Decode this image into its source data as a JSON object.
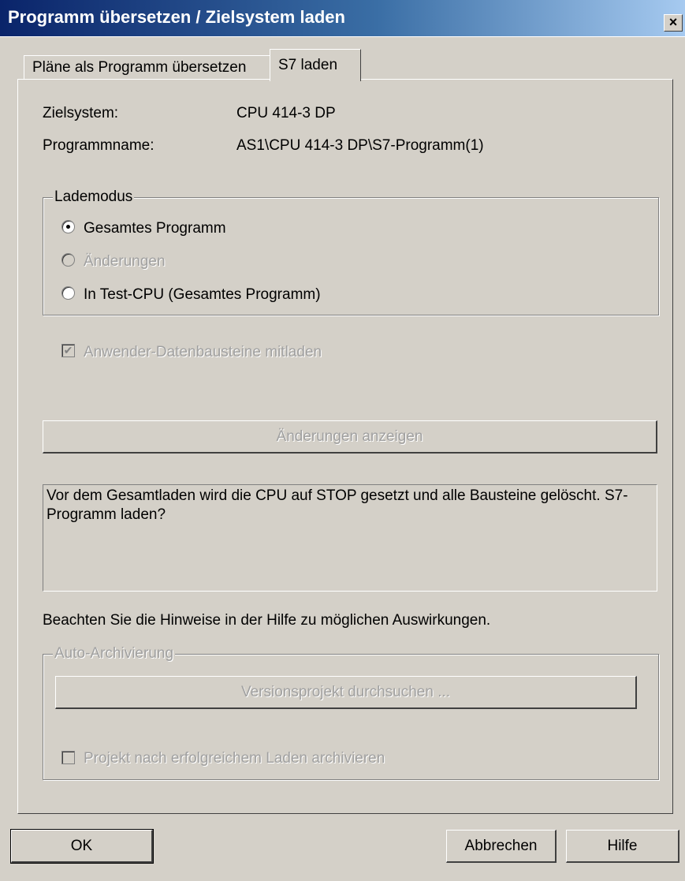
{
  "window": {
    "title": "Programm übersetzen / Zielsystem laden",
    "close_glyph": "×"
  },
  "tabs": [
    {
      "label": "Pläne als Programm übersetzen",
      "active": false
    },
    {
      "label": "S7 laden",
      "active": true
    }
  ],
  "info": {
    "target_label": "Zielsystem:",
    "target_value": "CPU 414-3 DP",
    "program_label": "Programmname:",
    "program_value": "AS1\\CPU 414-3 DP\\S7-Programm(1)"
  },
  "lademodus": {
    "legend": "Lademodus",
    "options": [
      {
        "label": "Gesamtes Programm",
        "checked": true,
        "enabled": true
      },
      {
        "label": "Änderungen",
        "checked": false,
        "enabled": false
      },
      {
        "label": "In Test-CPU (Gesamtes Programm)",
        "checked": false,
        "enabled": true
      }
    ]
  },
  "user_db_checkbox": {
    "label": "Anwender-Datenbausteine mitladen",
    "checked": true,
    "enabled": false
  },
  "show_changes_button": "Änderungen anzeigen",
  "message": "Vor dem Gesamtladen wird die CPU auf STOP gesetzt und alle Bausteine gelöscht. S7-Programm laden?",
  "hint": "Beachten Sie die Hinweise in der Hilfe zu möglichen Auswirkungen.",
  "auto_archive": {
    "legend": "Auto-Archivierung",
    "browse_button": "Versionsprojekt durchsuchen ...",
    "checkbox_label": "Projekt nach erfolgreichem Laden archivieren",
    "checked": false
  },
  "footer": {
    "ok": "OK",
    "cancel": "Abbrechen",
    "help": "Hilfe"
  }
}
